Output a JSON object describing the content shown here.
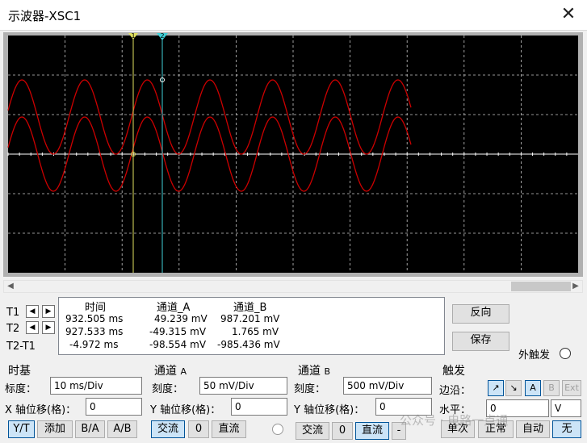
{
  "window": {
    "title": "示波器-XSC1",
    "close_glyph": "✕"
  },
  "scope": {
    "background": "#000000",
    "grid_color": "#c8c8c8",
    "channel_a_color": "#cc0000",
    "channel_b_color": "#cc0000",
    "cursor_t1_color": "#e0e060",
    "cursor_t2_color": "#40d0d8",
    "cursor_t1_label": "1",
    "cursor_t2_label": "2"
  },
  "readout": {
    "headers": [
      "时间",
      "通道_A",
      "通道_B"
    ],
    "rows": [
      {
        "label": "T1",
        "time": "932.505 ms",
        "a": "49.239 mV",
        "b": "987.201 mV"
      },
      {
        "label": "T2",
        "time": "927.533 ms",
        "a": "-49.315 mV",
        "b": "1.765 mV"
      },
      {
        "label": "T2-T1",
        "time": "-4.972 ms",
        "a": "-98.554 mV",
        "b": "-985.436 mV"
      }
    ],
    "arrow_left": "◀",
    "arrow_right": "▶"
  },
  "actions": {
    "reverse": "反向",
    "save": "保存",
    "ext_trigger": "外触发"
  },
  "timebase": {
    "header": "时基",
    "scale_label": "标度：",
    "scale_value": "10 ms/Div",
    "xpos_label": "X 轴位移(格)：",
    "xpos_value": "0",
    "modes": [
      "Y/T",
      "添加",
      "B/A",
      "A/B"
    ]
  },
  "channel_a": {
    "header": "通道",
    "header_suffix": "A",
    "scale_label": "刻度：",
    "scale_value": "50 mV/Div",
    "ypos_label": "Y 轴位移(格)：",
    "ypos_value": "0",
    "coupling": [
      "交流",
      "0",
      "直流"
    ]
  },
  "channel_b": {
    "header": "通道",
    "header_suffix": "B",
    "scale_label": "刻度：",
    "scale_value": "500 mV/Div",
    "ypos_label": "Y 轴位移(格)：",
    "ypos_value": "0",
    "coupling": [
      "交流",
      "0",
      "直流",
      "-"
    ]
  },
  "trigger": {
    "header": "触发",
    "edge_label": "边沿：",
    "edge_rise": "↗",
    "edge_fall": "↘",
    "sources": [
      "A",
      "B",
      "Ext"
    ],
    "level_label": "水平：",
    "level_value": "0",
    "level_unit": "V",
    "modes": [
      "单次",
      "正常",
      "自动",
      "无"
    ]
  },
  "watermark": "公众号 · 电路一点通"
}
